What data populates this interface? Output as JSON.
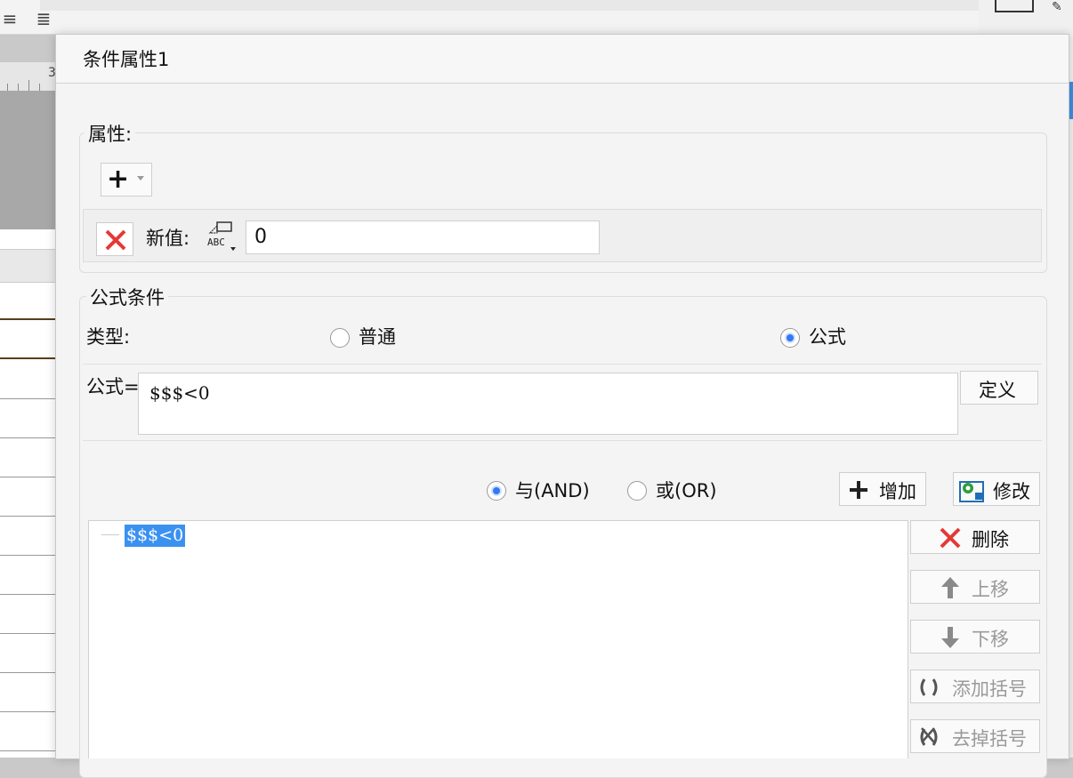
{
  "dialog": {
    "title": "条件属性1"
  },
  "properties": {
    "group_label": "属性:",
    "new_value_label": "新值:",
    "new_value": "0"
  },
  "formula_condition": {
    "group_label": "公式条件",
    "type_label": "类型:",
    "type_options": [
      "普通",
      "公式"
    ],
    "type_selected": "公式",
    "formula_label": "公式=",
    "formula_value": "$$$<0",
    "define_button": "定义",
    "logic_options": [
      "与(AND)",
      "或(OR)"
    ],
    "logic_selected": "与(AND)",
    "add_button": "增加",
    "modify_button": "修改",
    "conditions": [
      "$$$<0"
    ],
    "side_buttons": {
      "delete": "删除",
      "move_up": "上移",
      "move_down": "下移",
      "add_bracket": "添加括号",
      "remove_bracket": "去掉括号"
    }
  },
  "background": {
    "ruler_number": "3"
  },
  "colors": {
    "accent": "#3478f6",
    "selection": "#3b91f0",
    "delete_red": "#e53935",
    "modify_green": "#2e9e3e"
  }
}
